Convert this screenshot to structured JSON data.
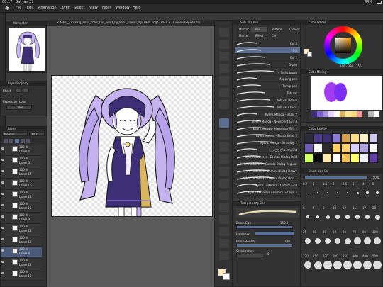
{
  "status": {
    "time": "00:17",
    "date": "Sat Jan 27",
    "battery": "44%"
  },
  "menu": [
    "File",
    "Edit",
    "Animation",
    "Layer",
    "Select",
    "View",
    "Filter",
    "Window",
    "Help"
  ],
  "document_tab": "× tobe__crossing_arms_color_the_heart_by_kabu_kawaii_dgo79d0.png* (2449 x 2835px 96dpi 40.6%)",
  "navigator": {
    "title": "Navigator"
  },
  "layer_property": {
    "title": "Layer Property",
    "effect_label": "Effect",
    "expression_color_label": "Expression color",
    "expression_color_value": "Color"
  },
  "layers_panel": {
    "title": "Layer",
    "blend": "Normal",
    "opacity": "100",
    "rows": [
      {
        "opacity": "100 %",
        "name": "Layer 4",
        "selected": false
      },
      {
        "opacity": "100 %",
        "name": "Layer 3",
        "selected": false
      },
      {
        "opacity": "100 %",
        "name": "Layer 17",
        "selected": false
      },
      {
        "opacity": "100 %",
        "name": "Layer 16",
        "selected": false
      },
      {
        "opacity": "100 %",
        "name": "Layer 14",
        "selected": false
      },
      {
        "opacity": "100 %",
        "name": "Layer 15",
        "selected": false
      },
      {
        "opacity": "100 %",
        "name": "Layer 9",
        "selected": false
      },
      {
        "opacity": "100 %",
        "name": "Layer 13",
        "selected": false
      },
      {
        "opacity": "100 %",
        "name": "Layer 12",
        "selected": false
      },
      {
        "opacity": "100 %",
        "name": "Layer 8",
        "selected": true
      },
      {
        "opacity": "100 %",
        "name": "Layer 11",
        "selected": false
      },
      {
        "opacity": "100 %",
        "name": "Layer 10",
        "selected": false
      }
    ]
  },
  "subtool": {
    "title": "Sub Tool Pen",
    "tabs": [
      "Marker",
      "Pen",
      "Pattern",
      "Cutlery"
    ],
    "tabs2": [
      "Marker",
      "Effect",
      "Cel"
    ],
    "brushes": [
      "Col 4",
      "Col",
      "Col 2",
      "G-pen",
      "(« ใส่เส้น brush",
      "Mapping pen",
      "Turnip pen",
      "Tubular",
      "Tubular Heavy",
      "Tubular Chunk",
      "Kyle's Manga - Bezel 2",
      "Kyle's Manga - Newsprint Grit 3",
      "Kyle's Manga - Harvester Grit 2",
      "Kyle's Manga - Sharp Small 2",
      "Kyle's Manga - Smoothy 2",
      "しっとりがまぺん Old",
      "Kyle's Letterers - Comics Dialog Bold",
      "Kyle's Letterers - Comics Dialog Regular",
      "Kyle's Letterers - Comics Dialog Heavy",
      "Kyle's Letterers - Comics Dialog Bold 1",
      "Kyle's Letterers - Comics Grid",
      "Kyle's Letterers - Comics Grunge 2"
    ],
    "selected_index": 1
  },
  "tool_property": {
    "title": "Tool property Col",
    "brush_size_label": "Brush Size",
    "brush_size_value": "150.0",
    "hardness_label": "Hardness",
    "brush_density_label": "Brush density",
    "brush_density_value": "100",
    "stabilization_label": "Stabilization",
    "stabilization_value": "0"
  },
  "color_wheel": {
    "title": "Color Wheel",
    "values": "346 · 338 · 250"
  },
  "color_mixing": {
    "title": "Color Mixing"
  },
  "color_palette": {
    "title": "Color Palette",
    "swatches": [
      "#2b2b3a",
      "#4b3c8c",
      "#3c2f76",
      "#8c7bd6",
      "#d6a04a",
      "#ffe08a",
      "#f9f0c8",
      "#cfc8ec",
      "#6d5bb5",
      "#ffffff",
      "#2c2c2c",
      "#ffd060",
      "#ffd070",
      "#d9d0ff",
      "#b0a0e0",
      "#ffffff",
      "#d0ff66",
      "#0a0a0a",
      "#ffe8a8",
      "#ffffff",
      "#eec050",
      "#ffff70",
      "#f2f2ff",
      "#6040a0"
    ]
  },
  "mix_swatches": [
    "#3e2d7a",
    "#7a5fd1",
    "#a58de0",
    "#e2d3ff",
    "#ffffff",
    "#d6b35a",
    "#ffe79a",
    "#ffd97c",
    "#ff9a9a",
    "#3a3a3a",
    "#b8b8b8",
    "#ffffff"
  ],
  "brush_size_panel": {
    "title": "Brush size Col",
    "value": "150.0",
    "sizes": [
      "0.7",
      "1",
      "1.5",
      "2",
      "2.5",
      "3",
      "4",
      "5",
      "6",
      "7",
      "8",
      "10",
      "12",
      "15",
      "17",
      "20",
      "25",
      "30",
      "40",
      "50",
      "60",
      "70",
      "80",
      "100",
      "120",
      "150",
      "170",
      "200",
      "250",
      "300",
      "400",
      "500"
    ]
  },
  "colors": {
    "accent": "#5b6f92",
    "hair": "#c5b3f0",
    "dress": "#3c2f76",
    "skin": "#ffffff"
  }
}
